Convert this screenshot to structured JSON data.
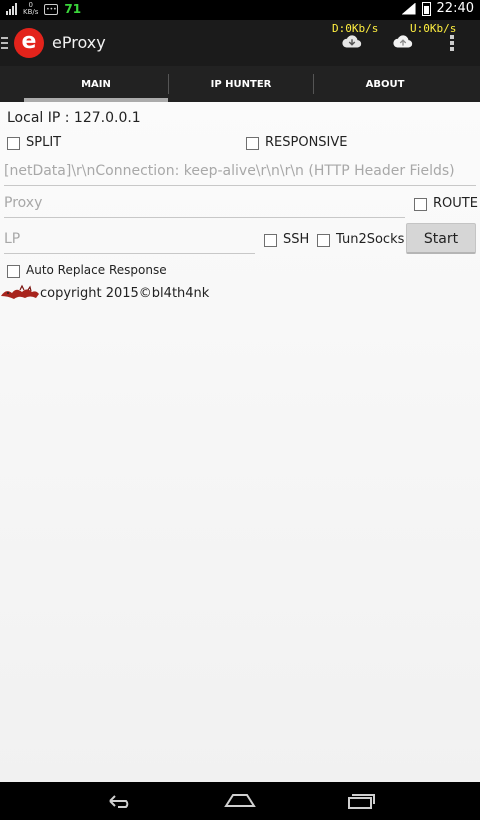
{
  "status_bar": {
    "net_speed_top": "0",
    "net_speed_unit": "KB/s",
    "notification_count": "71",
    "time": "22:40"
  },
  "action_bar": {
    "app_name": "eProxy",
    "logo_letter": "e",
    "download_speed": "D:0Kb/s",
    "upload_speed": "U:0Kb/s"
  },
  "tabs": [
    {
      "label": "MAIN",
      "active": true
    },
    {
      "label": "IP HUNTER",
      "active": false
    },
    {
      "label": "ABOUT",
      "active": false
    }
  ],
  "main": {
    "local_ip": "Local IP : 127.0.0.1",
    "split_label": "SPLIT",
    "responsive_label": "RESPONSIVE",
    "header_placeholder": "[netData]\\r\\nConnection: keep-alive\\r\\n\\r\\n (HTTP Header Fields)",
    "proxy_placeholder": "Proxy",
    "route_label": "ROUTE",
    "lp_placeholder": "LP",
    "ssh_label": "SSH",
    "tun2socks_label": "Tun2Socks",
    "start_label": "Start",
    "auto_replace_label": "Auto Replace Response",
    "copyright": "copyright 2015©bl4th4nk"
  },
  "colors": {
    "brand_red": "#e3231b",
    "speed_text": "#ffef40",
    "notification_green": "#3bd63b"
  },
  "icons": {
    "download": "cloud-download-icon",
    "upload": "cloud-upload-icon",
    "overflow": "overflow-menu-icon",
    "back": "back-icon",
    "home": "home-icon",
    "recents": "recents-icon"
  }
}
